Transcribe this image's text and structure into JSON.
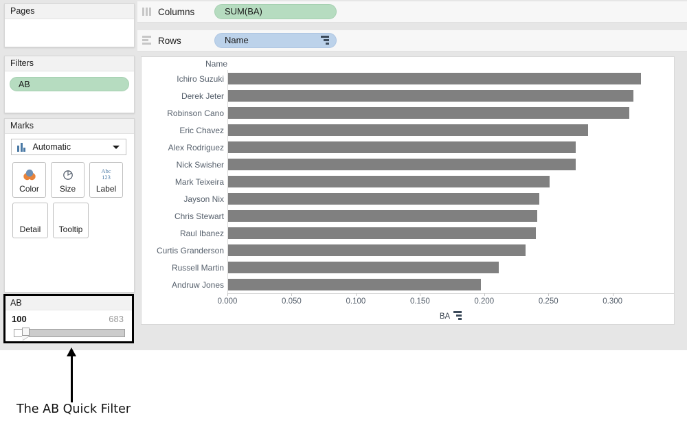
{
  "left_panel": {
    "pages": {
      "title": "Pages"
    },
    "filters": {
      "title": "Filters",
      "pills": [
        {
          "label": "AB"
        }
      ]
    },
    "marks": {
      "title": "Marks",
      "mark_type": "Automatic",
      "mark_type_icon": "bar-chart-icon",
      "buttons": [
        {
          "label": "Color",
          "icon": "color-circles-icon"
        },
        {
          "label": "Size",
          "icon": "size-pie-icon"
        },
        {
          "label": "Label",
          "icon": "abc-123-icon",
          "icon_text_top": "Abc",
          "icon_text_bottom": "123"
        },
        {
          "label": "Detail",
          "icon": ""
        },
        {
          "label": "Tooltip",
          "icon": ""
        }
      ]
    },
    "quick_filter": {
      "title": "AB",
      "min_value": "100",
      "max_value": "683",
      "handle_icon": "slider-handle-icon"
    }
  },
  "shelves": {
    "columns": {
      "label": "Columns",
      "icon": "columns-icon",
      "pill": "SUM(BA)"
    },
    "rows": {
      "label": "Rows",
      "icon": "rows-icon",
      "pill": "Name",
      "pill_icon": "sort-descending-icon"
    }
  },
  "annotation": {
    "text": "The AB Quick Filter",
    "arrow_icon": "up-arrow-icon"
  },
  "colors": {
    "pill_green": "#b6dcc0",
    "pill_blue": "#bcd2ea",
    "bar_gray": "#808080",
    "app_background": "#e6e6e6",
    "axis_text": "#555f6b"
  },
  "chart_data": {
    "type": "bar",
    "title": "",
    "orientation": "horizontal",
    "xlabel": "BA",
    "ylabel": "Name",
    "row_header": "Name",
    "categories": [
      "Ichiro Suzuki",
      "Derek Jeter",
      "Robinson Cano",
      "Eric Chavez",
      "Alex Rodriguez",
      "Nick Swisher",
      "Mark Teixeira",
      "Jayson Nix",
      "Chris Stewart",
      "Raul Ibanez",
      "Curtis Granderson",
      "Russell Martin",
      "Andruw Jones"
    ],
    "values": [
      0.322,
      0.316,
      0.313,
      0.281,
      0.271,
      0.271,
      0.251,
      0.243,
      0.241,
      0.24,
      0.232,
      0.211,
      0.197
    ],
    "xlim": [
      0,
      0.3478
    ],
    "xticks": [
      0.0,
      0.05,
      0.1,
      0.15,
      0.2,
      0.25,
      0.3
    ],
    "xtick_labels": [
      "0.000",
      "0.050",
      "0.100",
      "0.150",
      "0.200",
      "0.250",
      "0.300"
    ],
    "grid": false,
    "legend": "none",
    "sort": "descending"
  }
}
